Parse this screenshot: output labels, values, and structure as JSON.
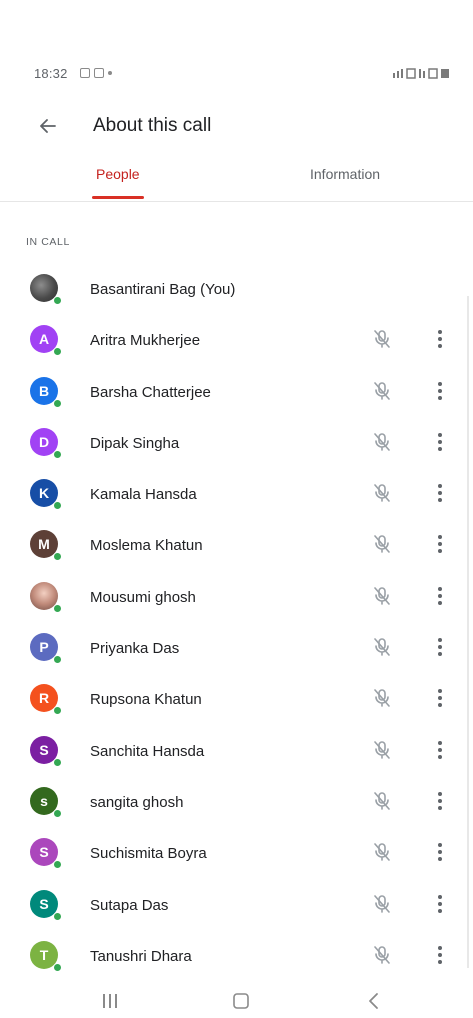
{
  "status_bar": {
    "time": "18:32",
    "right_text": ""
  },
  "header": {
    "title": "About this call",
    "back_icon": "arrow-left-icon"
  },
  "tabs": [
    {
      "label": "People",
      "selected": true
    },
    {
      "label": "Information",
      "selected": false
    }
  ],
  "section": {
    "label": "IN CALL"
  },
  "participants": [
    {
      "name": "Basantirani Bag (You)",
      "initial": "",
      "color": "#555555",
      "photo": "photo1",
      "muted_icon": false
    },
    {
      "name": "Aritra Mukherjee",
      "initial": "A",
      "color": "#a142f4",
      "muted_icon": true
    },
    {
      "name": "Barsha Chatterjee",
      "initial": "B",
      "color": "#1a73e8",
      "muted_icon": true
    },
    {
      "name": "Dipak Singha",
      "initial": "D",
      "color": "#a142f4",
      "muted_icon": true
    },
    {
      "name": "Kamala Hansda",
      "initial": "K",
      "color": "#174ea6",
      "muted_icon": true
    },
    {
      "name": "Moslema Khatun",
      "initial": "M",
      "color": "#5d4037",
      "muted_icon": true
    },
    {
      "name": "Mousumi ghosh",
      "initial": "",
      "color": "#c08a7a",
      "photo": "photo2",
      "muted_icon": true
    },
    {
      "name": "Priyanka Das",
      "initial": "P",
      "color": "#5c6bc0",
      "muted_icon": true
    },
    {
      "name": "Rupsona Khatun",
      "initial": "R",
      "color": "#f4511e",
      "muted_icon": true
    },
    {
      "name": "Sanchita Hansda",
      "initial": "S",
      "color": "#7b1fa2",
      "muted_icon": true
    },
    {
      "name": "sangita ghosh",
      "initial": "s",
      "color": "#33691e",
      "muted_icon": true
    },
    {
      "name": "Suchismita Boyra",
      "initial": "S",
      "color": "#ab47bc",
      "muted_icon": true
    },
    {
      "name": "Sutapa Das",
      "initial": "S",
      "color": "#00897b",
      "muted_icon": true
    },
    {
      "name": "Tanushri Dhara",
      "initial": "T",
      "color": "#7cb342",
      "muted_icon": true
    }
  ],
  "icons": {
    "mic": "mic-off-icon",
    "more": "more-vert-icon"
  },
  "nav": {
    "recent": "recent-apps-icon",
    "home": "home-icon",
    "back": "nav-back-icon"
  }
}
